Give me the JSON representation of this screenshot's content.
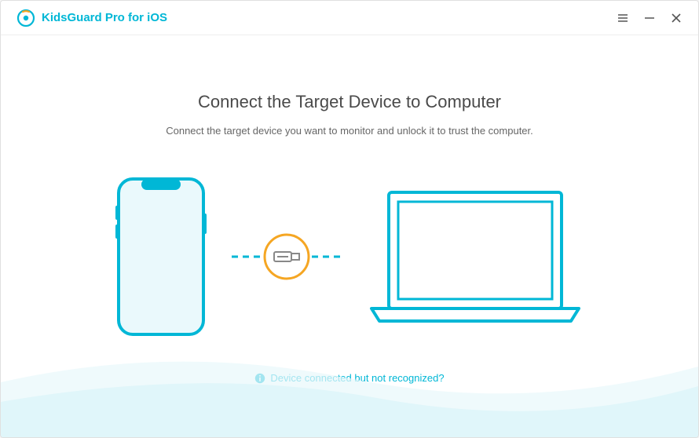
{
  "brand": {
    "name": "KidsGuard Pro for iOS"
  },
  "main": {
    "title": "Connect the Target Device to Computer",
    "subtitle": "Connect the target device you want to monitor and unlock it to trust the computer."
  },
  "help": {
    "link_text": "Device connected but not recognized?"
  },
  "colors": {
    "primary": "#00b7d6",
    "accent": "#f5a623",
    "text_dark": "#4a4a4a",
    "text_light": "#666666"
  }
}
